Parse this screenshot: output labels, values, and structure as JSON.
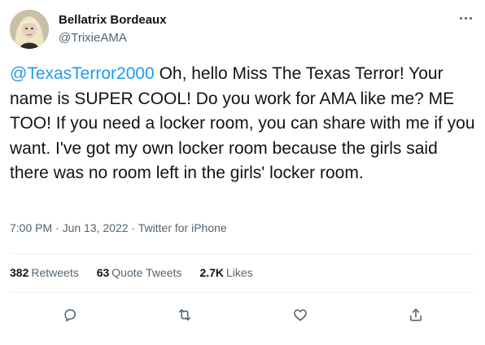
{
  "user": {
    "display_name": "Bellatrix Bordeaux",
    "handle": "@TrixieAMA"
  },
  "tweet": {
    "mention": "@TexasTerror2000",
    "text": " Oh, hello Miss The Texas Terror! Your name is SUPER COOL! Do you work for AMA like me? ME TOO! If you need a locker room, you can share with me if you want. I've got my own locker room because the girls said there was no room left in the girls' locker room.",
    "time": "7:00 PM",
    "date": "Jun 13, 2022",
    "source": "Twitter for iPhone",
    "separator": " · "
  },
  "stats": {
    "retweets_count": "382",
    "retweets_label": "Retweets",
    "quotes_count": "63",
    "quotes_label": "Quote Tweets",
    "likes_count": "2.7K",
    "likes_label": "Likes"
  },
  "icons": {
    "more": "more-icon",
    "reply": "reply-icon",
    "retweet": "retweet-icon",
    "like": "like-icon",
    "share": "share-icon"
  },
  "colors": {
    "accent": "#1d9bf0",
    "text": "#0f1419",
    "muted": "#536471",
    "divider": "#eff3f4"
  }
}
